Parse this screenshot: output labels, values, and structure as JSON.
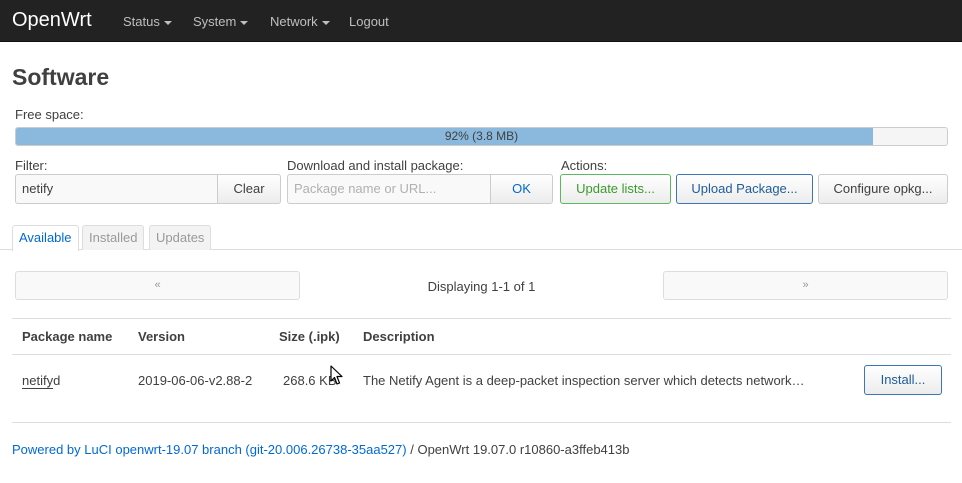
{
  "navbar": {
    "brand": "OpenWrt",
    "items": [
      {
        "label": "Status",
        "has_caret": true
      },
      {
        "label": "System",
        "has_caret": true
      },
      {
        "label": "Network",
        "has_caret": true
      },
      {
        "label": "Logout",
        "has_caret": false
      }
    ]
  },
  "page": {
    "title": "Software"
  },
  "free_space": {
    "label": "Free space:",
    "text": "92% (3.8 MB)",
    "fraction": 0.92
  },
  "filter": {
    "label": "Filter:",
    "value": "netify",
    "clear_label": "Clear"
  },
  "download": {
    "label": "Download and install package:",
    "placeholder": "Package name or URL...",
    "ok_label": "OK"
  },
  "actions": {
    "label": "Actions:",
    "update_lists": "Update lists...",
    "upload_package": "Upload Package...",
    "configure_opkg": "Configure opkg..."
  },
  "tabs": [
    {
      "label": "Available",
      "active": true
    },
    {
      "label": "Installed",
      "active": false
    },
    {
      "label": "Updates",
      "active": false
    }
  ],
  "pager": {
    "prev": "«",
    "next": "»",
    "status": "Displaying 1-1 of 1"
  },
  "table": {
    "headers": [
      "Package name",
      "Version",
      "Size (.ipk)",
      "Description"
    ],
    "rows": [
      {
        "name_match": "netify",
        "name_rest": "d",
        "version": "2019-06-06-v2.88-2",
        "size": "268.6 KB",
        "desc_pre": "The ",
        "desc_match": "Netify",
        "desc_post": " Agent is a deep-packet inspection server which detects network…",
        "action": "Install..."
      }
    ]
  },
  "footer": {
    "link": "Powered by LuCI openwrt-19.07 branch (git-20.006.26738-35aa527)",
    "separator": " / ",
    "version": "OpenWrt 19.07.0 r10860-a3ffeb413b"
  },
  "colors": {
    "navbar": "#222222",
    "progress": "#8ab9dd",
    "link": "#0069d6",
    "success": "#5cb85c"
  },
  "icons": {
    "cursor": "mouse-pointer-icon",
    "caret": "caret-down-icon"
  }
}
